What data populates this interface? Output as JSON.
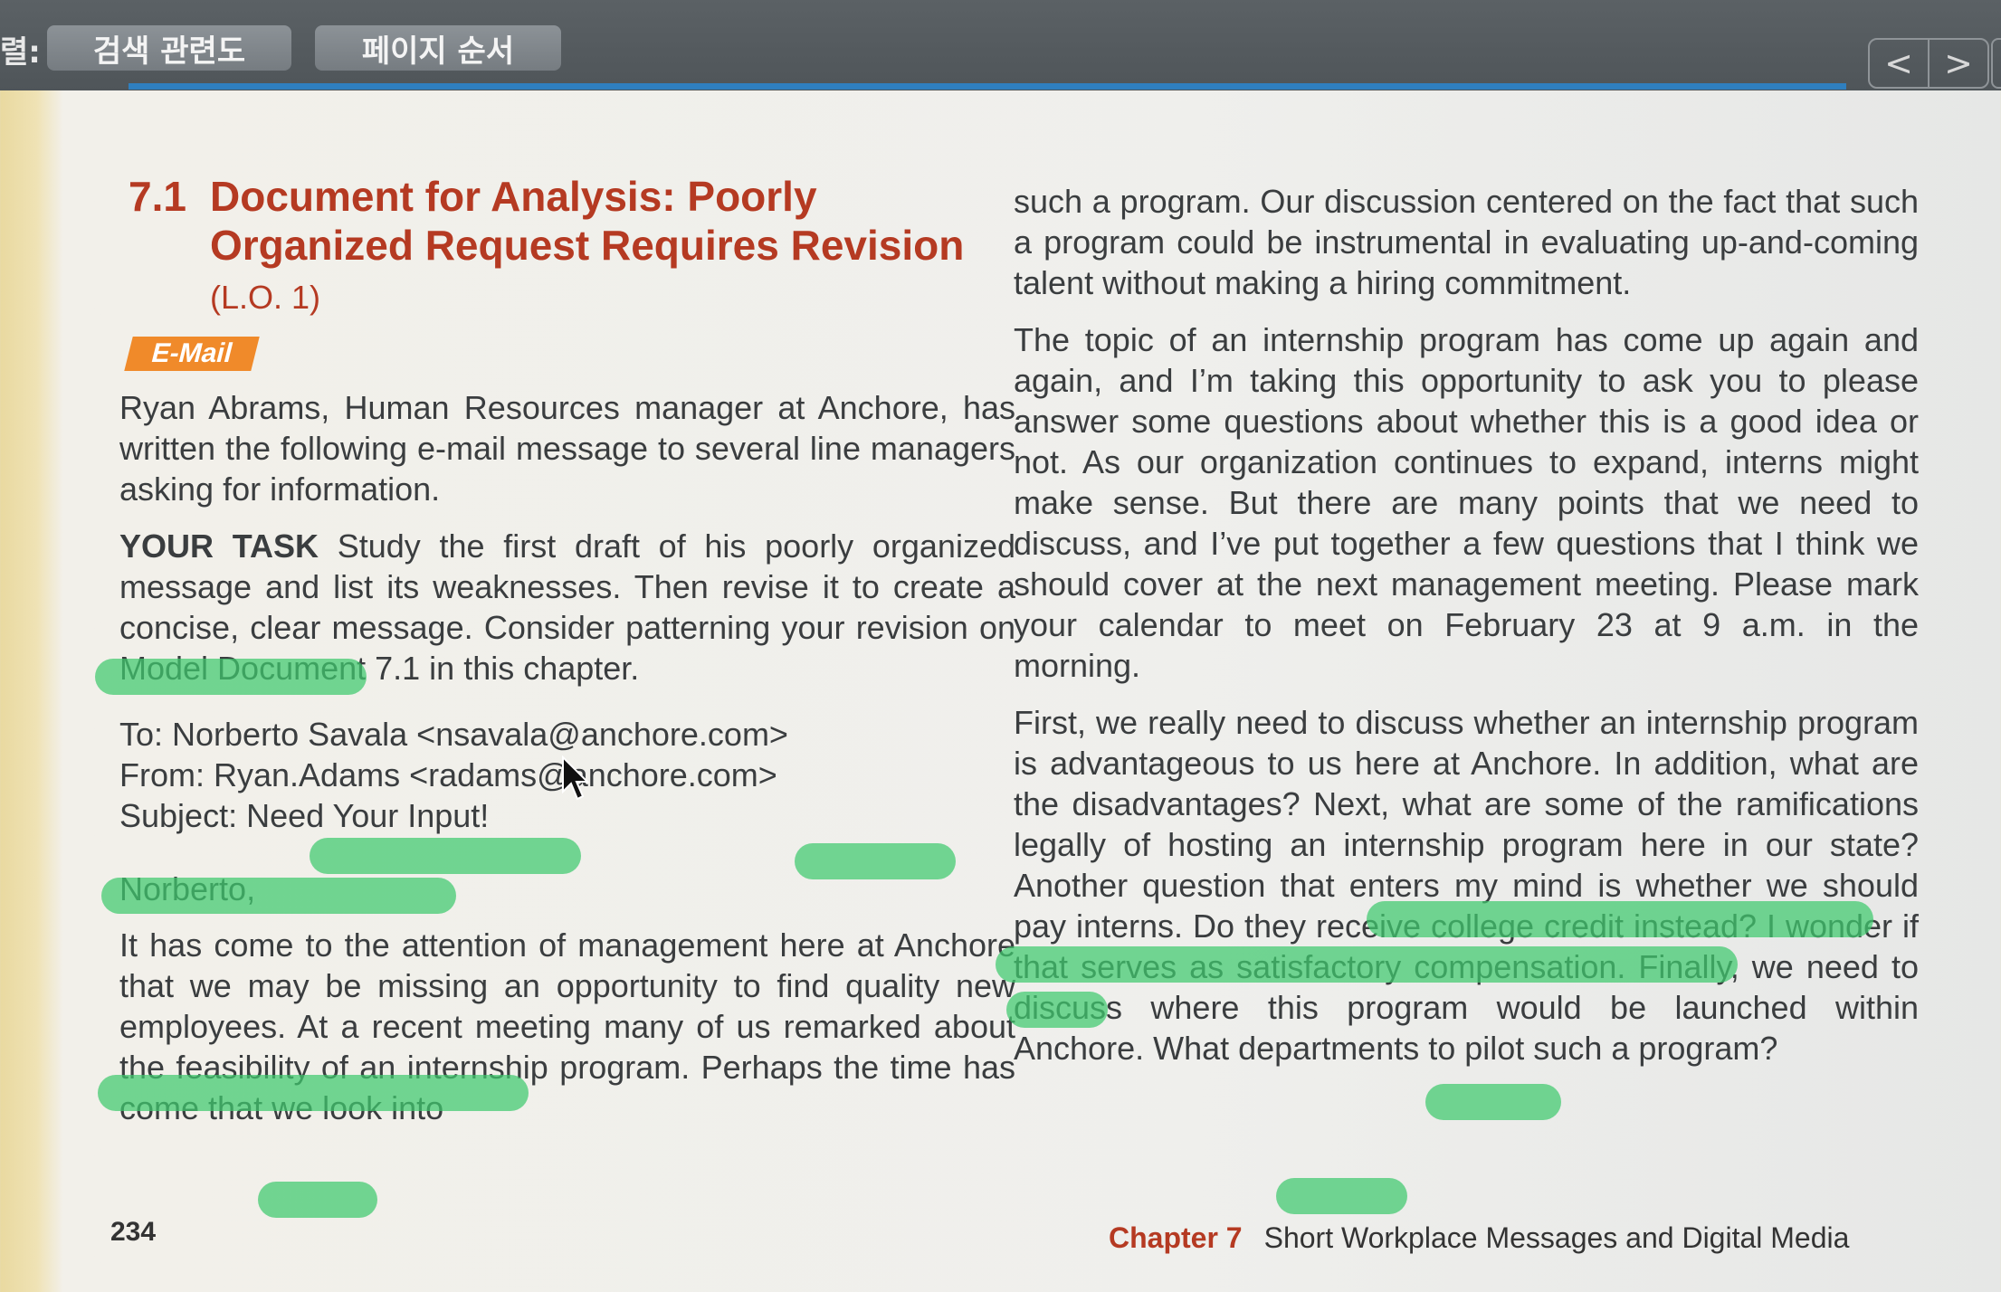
{
  "toolbar": {
    "label": "렬:",
    "tabs": [
      "검색 관련도",
      "페이지 순서"
    ],
    "nav_prev": "<",
    "nav_next": ">"
  },
  "heading": {
    "number": "7.1",
    "title": "Document for Analysis: Poorly Organized Request Requires Revision",
    "lo": "(L.O. 1)"
  },
  "tag": "E-Mail",
  "intro": "Ryan Abrams, Human Resources manager at Anchore, has written the following e-mail message to several line managers asking for information.",
  "task": {
    "label": "YOUR TASK",
    "text": " Study the first draft of his poorly organized message and list its weaknesses. Then revise it to create a concise, clear message. Consider patterning your revision on Model Document 7.1 in this chapter."
  },
  "email": {
    "to": "To: Norberto Savala <nsavala@anchore.com>",
    "from": "From: Ryan.Adams <radams@anchore.com>",
    "subject": "Subject: Need Your Input!",
    "salutation": "Norberto,",
    "p1": "It has come to the attention of management here at Anchore that we may be missing an opportunity to find quality new employees. At a recent meeting many of us remarked about the feasibility of an internship program. Perhaps the time has come that we look into",
    "p1_cont": "such a program. Our discussion centered on the fact that such a program could be instrumental in evaluating up-and-coming talent without making a hiring commitment.",
    "p2": "The topic of an internship program has come up again and again, and I’m taking this opportunity to ask you to please answer some questions about whether this is a good idea or not. As our organization continues to expand, interns might make sense. But there are many points that we need to discuss, and I’ve put together a few questions that I think we should cover at the next management meeting. Please mark your calendar to meet on February 23 at 9 a.m. in the morning.",
    "p3": "First, we really need to discuss whether an internship program is advantageous to us here at Anchore. In addition, what are the disadvantages? Next, what are some of the ramifications legally of hosting an internship program here in our state? Another question that enters my mind is whether we should pay interns. Do they receive college credit instead? I wonder if that serves as satisfactory compensation. Finally, we need to discuss where this program would be launched within Anchore. What departments to pilot such a program?"
  },
  "footer": {
    "page_number": "234",
    "chapter_label": "Chapter 7",
    "chapter_title": "Short Workplace Messages and Digital Media"
  },
  "colors": {
    "heading": "#b53a22",
    "tag": "#f08a2a",
    "highlight": "#3fc96e",
    "toolbar": "#555b5f",
    "progress": "#2f7fbf"
  }
}
